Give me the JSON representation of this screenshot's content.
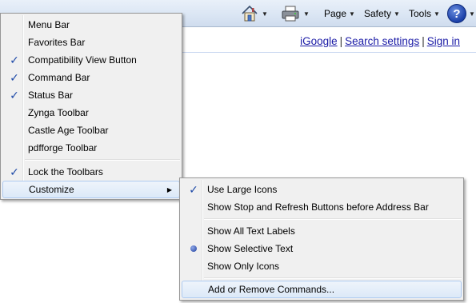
{
  "commandbar": {
    "home_icon": "home-icon",
    "print_icon": "printer-icon",
    "page_label": "Page",
    "safety_label": "Safety",
    "tools_label": "Tools",
    "help_icon": "help-icon",
    "help_glyph": "?",
    "dropdown_glyph": "▼"
  },
  "page": {
    "links": [
      "iGoogle",
      "Search settings",
      "Sign in"
    ],
    "separator": "|"
  },
  "toolbars_menu": {
    "items": [
      {
        "label": "Menu Bar",
        "checked": false
      },
      {
        "label": "Favorites Bar",
        "checked": false
      },
      {
        "label": "Compatibility View Button",
        "checked": true
      },
      {
        "label": "Command Bar",
        "checked": true
      },
      {
        "label": "Status Bar",
        "checked": true
      },
      {
        "label": "Zynga Toolbar",
        "checked": false
      },
      {
        "label": "Castle Age Toolbar",
        "checked": false
      },
      {
        "label": "pdfforge Toolbar",
        "checked": false
      }
    ],
    "lock_label": "Lock the Toolbars",
    "lock_checked": true,
    "customize_label": "Customize",
    "check_glyph": "✓",
    "submenu_glyph": "▶"
  },
  "customize_menu": {
    "large_icons_label": "Use Large Icons",
    "large_icons_checked": true,
    "stop_refresh_label": "Show Stop and Refresh Buttons before Address Bar",
    "text_options": [
      {
        "label": "Show All Text Labels",
        "selected": false
      },
      {
        "label": "Show Selective Text",
        "selected": true
      },
      {
        "label": "Show Only Icons",
        "selected": false
      }
    ],
    "add_remove_label": "Add or Remove Commands..."
  }
}
